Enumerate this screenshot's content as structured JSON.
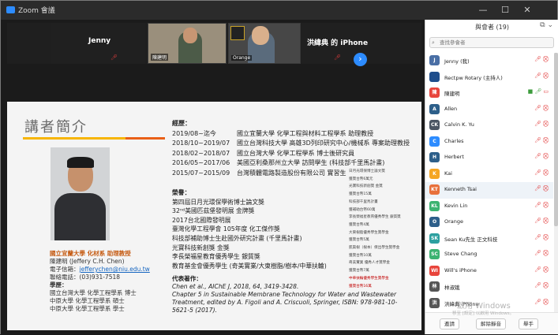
{
  "window": {
    "title": "Zoom 會議",
    "controls": [
      "—",
      "☐",
      "✕"
    ]
  },
  "videos": {
    "tiles": [
      {
        "name": "Jenny"
      },
      {
        "name": "陳建明"
      },
      {
        "name": "Orange"
      },
      {
        "name": "洪緯典 的 iPhone"
      }
    ],
    "next_label": "›"
  },
  "slide": {
    "heading": "講者簡介",
    "left": {
      "org": "國立宜蘭大學 化材系 助理教授",
      "name": "陳建明 (Jeffery C.H. Chen)",
      "email_label": "電子信箱：",
      "email": "jefferychen@niu.edu.tw",
      "phone": "聯絡電話：(03)931-7518",
      "edu_head": "學歷：",
      "edu": [
        "國立台灣大學 化學工程學系 博士",
        "中原大學 化學工程學系 碩士",
        "中原大學 化學工程學系 學士"
      ]
    },
    "exp_head": "經歷：",
    "experience": [
      {
        "date": "2019/08~迄今",
        "text": "國立宜蘭大學 化學工程與材料工程學系 助理教授"
      },
      {
        "date": "2018/10~2019/07",
        "text": "國立台灣科技大學 高雄3D列印研究中心/機械系 專案助理教授"
      },
      {
        "date": "2018/02~2018/07",
        "text": "國立台灣大學 化學工程學系 博士後研究員"
      },
      {
        "date": "2016/05~2017/06",
        "text": "美國亞利桑那州立大學 訪問學生 (科技部千里馬計畫)"
      },
      {
        "date": "2015/07~2015/09",
        "text": "台灣積體電路製造股份有限公司 實習生"
      }
    ],
    "hon_head": "榮譽：",
    "honors": [
      "第四屆日月光環保學術博士論文獎",
      "32ⁿᵈ美國匹茲堡發明展 金牌獎",
      "2017台北國際發明展",
      "臺灣化學工程學會 105年度 化工傑作獎",
      "科技部補助博士生赴國外研究計畫 (千里馬計畫)",
      "光寶科技新創獎 金獎",
      "李長榮福星教育優秀學生 銀質獎",
      "教育基金會優秀學生 (奇美實業/大東樹脂/樹本/中華扶輪)"
    ],
    "pub_head": "代表著作：",
    "pub1": "Chen et al., AIChE J, 2018, 64, 3419-3428.",
    "pub2": "Chapter 5 in Sustainable Membrane Technology for Water and Wastewater Treatment, edited by A. Figoli and A. Criscuoli, Springer, ISBN: 978-981-10-5621-5 (2017).",
    "side": [
      "日月光環保博士論文獎",
      "獲獎台幣6萬元",
      "光寶科技新創獎 金獎",
      "獲獎台幣15萬",
      "科技部千里馬計畫",
      "獲補助台幣60萬",
      "李長榮福星教育優秀學生 銀質獎",
      "獲獎台幣4萬",
      "大東樹脂優秀學生獎學金",
      "獲獎台幣5萬",
      "凱築樹（樹本）傑出學生獎學金",
      "獲獎台幣10萬",
      "奇美實業 優秀人才獎學金",
      "獲獎台幣7萬",
      "中華扶輪優秀學生獎學金",
      "獲獎台幣16萬"
    ]
  },
  "panel": {
    "title": "與會者 (19)",
    "search_placeholder": "查找參會者",
    "participants": [
      {
        "initials": "J",
        "name": "Jenny (我)",
        "color": "#4a6fa5"
      },
      {
        "initials": "",
        "name": "Rectpw Rotary (主持人)",
        "color": "#1f4e8c"
      },
      {
        "initials": "陳",
        "name": "陳建明",
        "color": "#e8453c"
      },
      {
        "initials": "A",
        "name": "Allen",
        "color": "#2d5f8a"
      },
      {
        "initials": "CK",
        "name": "Calvin K. Yu",
        "color": "#4b5563"
      },
      {
        "initials": "C",
        "name": "Charles",
        "color": "#2d8cff"
      },
      {
        "initials": "H",
        "name": "Herbert",
        "color": "#2d5f8a"
      },
      {
        "initials": "K",
        "name": "Kai",
        "color": "#f5a623"
      },
      {
        "initials": "KT",
        "name": "Kenneth Tsai",
        "color": "#e8713c"
      },
      {
        "initials": "KL",
        "name": "Kevin Lin",
        "color": "#3cb371"
      },
      {
        "initials": "O",
        "name": "Orange",
        "color": "#2d5f8a"
      },
      {
        "initials": "SK",
        "name": "Sean Ku先生 正文科技",
        "color": "#2da0a0"
      },
      {
        "initials": "SC",
        "name": "Steve Chang",
        "color": "#3cb371"
      },
      {
        "initials": "WI",
        "name": "Will's iPhone",
        "color": "#e8453c"
      },
      {
        "initials": "林",
        "name": "林淑娥",
        "color": "#555"
      },
      {
        "initials": "洪",
        "name": "洪緯典 iPhone",
        "color": "#555"
      }
    ],
    "buttons": [
      "邀請",
      "解除靜音",
      "舉手"
    ]
  },
  "watermark": {
    "line1": "啟用 Windows",
    "line2": "移至 [設定] 以啟用 Windows。"
  }
}
